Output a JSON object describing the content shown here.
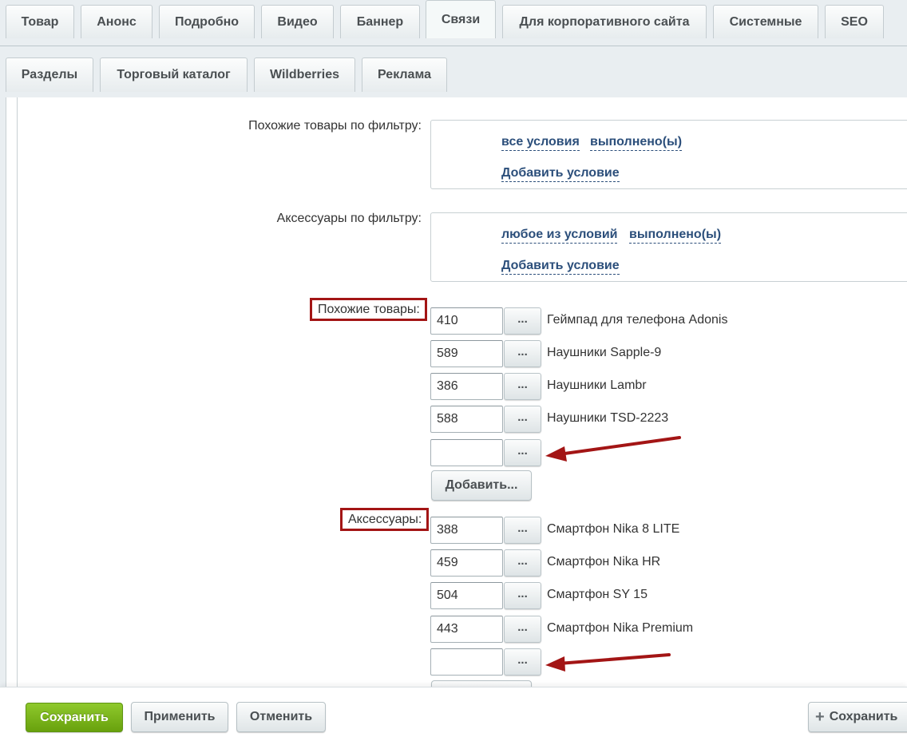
{
  "tabs_top": [
    {
      "label": "Товар"
    },
    {
      "label": "Анонс"
    },
    {
      "label": "Подробно"
    },
    {
      "label": "Видео"
    },
    {
      "label": "Баннер"
    },
    {
      "label": "Связи",
      "active": true
    },
    {
      "label": "Для корпоративного сайта"
    },
    {
      "label": "Системные"
    },
    {
      "label": "SEO"
    }
  ],
  "tabs_sub": [
    {
      "label": "Разделы"
    },
    {
      "label": "Торговый каталог"
    },
    {
      "label": "Wildberries"
    },
    {
      "label": "Реклама"
    }
  ],
  "similar_filter": {
    "label": "Похожие товары по фильтру:",
    "cond_mode": "все условия",
    "cond_state": "выполнено(ы)",
    "add_condition": "Добавить условие"
  },
  "accessories_filter": {
    "label": "Аксессуары по фильтру:",
    "cond_mode": "любое из условий",
    "cond_state": "выполнено(ы)",
    "add_condition": "Добавить условие"
  },
  "similar_products": {
    "label": "Похожие товары:",
    "items": [
      {
        "id": "410",
        "name": "Геймпад для телефона Adonis"
      },
      {
        "id": "589",
        "name": "Наушники Sapple-9"
      },
      {
        "id": "386",
        "name": "Наушники Lambr"
      },
      {
        "id": "588",
        "name": "Наушники TSD-2223"
      },
      {
        "id": "",
        "name": ""
      }
    ],
    "dots_label": "...",
    "add_button": "Добавить..."
  },
  "accessories": {
    "label": "Аксессуары:",
    "items": [
      {
        "id": "388",
        "name": "Смартфон Nika 8 LITE"
      },
      {
        "id": "459",
        "name": "Смартфон Nika HR"
      },
      {
        "id": "504",
        "name": "Смартфон SY 15"
      },
      {
        "id": "443",
        "name": "Смартфон Nika Premium"
      },
      {
        "id": "",
        "name": ""
      }
    ],
    "dots_label": "..."
  },
  "footer": {
    "save": "Сохранить",
    "apply": "Применить",
    "cancel": "Отменить",
    "save_right": "Сохранить",
    "plus_icon": "+"
  },
  "colors": {
    "accent_green": "#7ab61f",
    "highlight_red": "#a31515",
    "link_blue": "#2c4f7b"
  }
}
